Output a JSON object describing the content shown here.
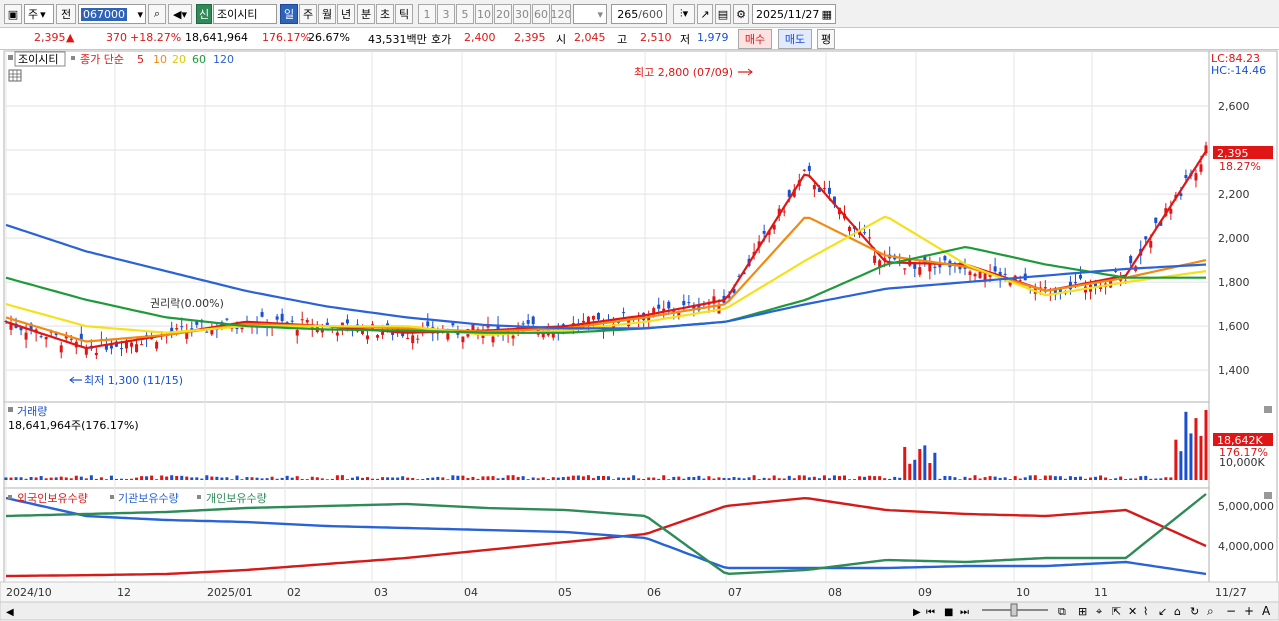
{
  "toolbar": {
    "market": "주",
    "period_short": "전",
    "code": "067000",
    "badge": "신",
    "name": "조이시티",
    "periods": [
      "일",
      "주",
      "월",
      "년",
      "분",
      "초",
      "틱"
    ],
    "active_period": "일",
    "minutes": [
      "1",
      "3",
      "5",
      "10",
      "20",
      "30",
      "60",
      "120"
    ],
    "count_value": "265",
    "count_max": "/600",
    "date": "2025/11/27"
  },
  "quote": {
    "price": "2,395",
    "arrow": "▲",
    "change": "370",
    "change_pct": "+18.27%",
    "volume": "18,641,964",
    "volume_ratio": "176.17%",
    "turnover": "26.67%",
    "amount": "43,531백만",
    "ask_label": "호가",
    "ask": "2,400",
    "bid": "2,395",
    "open_label": "시",
    "open": "2,045",
    "high_label": "고",
    "high": "2,510",
    "low_label": "저",
    "low": "1,979",
    "buy_label": "매수",
    "sell_label": "매도",
    "avg_label": "평"
  },
  "colors": {
    "up": "#e01515",
    "down": "#1a4fd0",
    "ma5": "#e01515",
    "ma10": "#f08a10",
    "ma20": "#f5e11a",
    "ma60": "#1f9a3a",
    "ma120": "#2a62d8",
    "foreign": "#d61a1a",
    "institution": "#2a62d8",
    "individual": "#2e8b57"
  },
  "price_panel": {
    "title": "조이시티",
    "legend_prefix": "종가 단순",
    "ma_labels": [
      "5",
      "10",
      "20",
      "60",
      "120"
    ],
    "lc": "LC:84.23",
    "hc": "HC:-14.46",
    "high_annot": "최고 2,800 (07/09)",
    "low_annot": "최저 1,300 (11/15)",
    "ex_annot": "권리락(0.00%)",
    "y_ticks": [
      "2,600",
      "2,400",
      "2,200",
      "2,000",
      "1,800",
      "1,600",
      "1,400"
    ],
    "price_tag": "2,395",
    "pct_tag": "18.27%"
  },
  "volume_panel": {
    "title": "거래량",
    "value": "18,641,964주(176.17%)",
    "tag": "18,642K",
    "pct_tag": "176.17%",
    "tick": "10,000K"
  },
  "holding_panel": {
    "labels": [
      "외국인보유수량",
      "기관보유수량",
      "개인보유수량"
    ],
    "y_ticks": [
      "5,000,000",
      "4,000,000"
    ]
  },
  "x_axis": [
    "2024/10",
    "12",
    "2025/01",
    "02",
    "03",
    "04",
    "05",
    "06",
    "07",
    "08",
    "09",
    "10",
    "11",
    "11/27"
  ],
  "chart_data": [
    {
      "type": "line",
      "title": "조이시티",
      "ylim": [
        1260,
        2850
      ],
      "x": [
        "2024/10",
        "12",
        "2025/01",
        "02",
        "03",
        "04",
        "05",
        "06",
        "07",
        "08",
        "09",
        "10",
        "11",
        "11/27"
      ],
      "series": [
        {
          "name": "5",
          "values": [
            1620,
            1500,
            1560,
            1620,
            1600,
            1570,
            1580,
            1600,
            1650,
            1720,
            2300,
            1890,
            1880,
            1760,
            1830,
            2395
          ]
        },
        {
          "name": "10",
          "values": [
            1640,
            1530,
            1560,
            1610,
            1600,
            1590,
            1575,
            1590,
            1640,
            1700,
            2100,
            1920,
            1870,
            1760,
            1820,
            1900
          ]
        },
        {
          "name": "20",
          "values": [
            1700,
            1600,
            1570,
            1600,
            1600,
            1600,
            1560,
            1580,
            1620,
            1680,
            1900,
            2100,
            1880,
            1740,
            1800,
            1850
          ]
        },
        {
          "name": "60",
          "values": [
            1820,
            1720,
            1640,
            1600,
            1585,
            1580,
            1570,
            1570,
            1590,
            1620,
            1720,
            1880,
            1960,
            1880,
            1820,
            1820
          ]
        },
        {
          "name": "120",
          "values": [
            2060,
            1940,
            1850,
            1760,
            1690,
            1640,
            1605,
            1590,
            1590,
            1620,
            1700,
            1770,
            1800,
            1830,
            1860,
            1880
          ]
        }
      ],
      "annotations": [
        "최고 2,800 (07/09)",
        "최저 1,300 (11/15)"
      ]
    },
    {
      "type": "bar",
      "title": "거래량",
      "unit": "K",
      "last_value": 18642
    },
    {
      "type": "line",
      "ylim": [
        3150000,
        5400000
      ],
      "series": [
        {
          "name": "외국인보유수량",
          "values": [
            3250000,
            3270000,
            3300000,
            3400000,
            3550000,
            3700000,
            3900000,
            4100000,
            4300000,
            5000000,
            5200000,
            4900000,
            4800000,
            4750000,
            4900000,
            4000000
          ]
        },
        {
          "name": "기관보유수량",
          "values": [
            5200000,
            4750000,
            4650000,
            4600000,
            4500000,
            4450000,
            4400000,
            4350000,
            4200000,
            3450000,
            3450000,
            3450000,
            3500000,
            3500000,
            3600000,
            3300000
          ]
        },
        {
          "name": "개인보유수량",
          "values": [
            4750000,
            4800000,
            4850000,
            4950000,
            5000000,
            5050000,
            4950000,
            4900000,
            4750000,
            3300000,
            3400000,
            3650000,
            3600000,
            3700000,
            3700000,
            5300000
          ]
        }
      ]
    }
  ]
}
